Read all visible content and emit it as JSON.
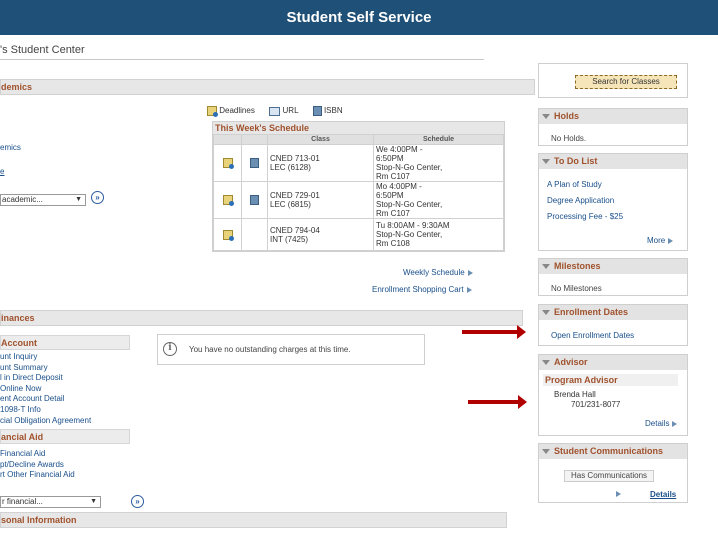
{
  "header": {
    "title": "Student Self Service"
  },
  "page": {
    "title": "'s Student Center"
  },
  "academics": {
    "section_title": "demics",
    "links": [
      "emics",
      "e"
    ],
    "dropdown": "academic...",
    "go": "»",
    "toolbar": {
      "deadlines": "Deadlines",
      "url": "URL",
      "isbn": "ISBN"
    },
    "schedule": {
      "title": "This Week's Schedule",
      "columns": [
        "Class",
        "Schedule"
      ],
      "rows": [
        {
          "class_line1": "CNED 713-01",
          "class_line2": "LEC (6128)",
          "sched": [
            "We 4:00PM -",
            "6:50PM",
            "Stop-N-Go Center,",
            "Rm C107"
          ]
        },
        {
          "class_line1": "CNED 729-01",
          "class_line2": "LEC (6815)",
          "sched": [
            "Mo 4:00PM -",
            "6:50PM",
            "Stop-N-Go Center,",
            "Rm C107"
          ]
        },
        {
          "class_line1": "CNED 794-04",
          "class_line2": "INT (7425)",
          "sched": [
            "Tu 8:00AM - 9:30AM",
            "Stop-N-Go Center,",
            "Rm C108"
          ]
        }
      ]
    },
    "weekly_schedule": "Weekly Schedule",
    "shopping_cart": "Enrollment Shopping Cart"
  },
  "finances": {
    "section_title": "inances",
    "account_title": "Account",
    "account_links": [
      "unt Inquiry",
      "unt Summary",
      "l in Direct Deposit",
      "Online Now",
      "ent Account Detail",
      "1098-T Info",
      "cial Obligation Agreement"
    ],
    "aid_title": "ancial Aid",
    "aid_links": [
      "Financial Aid",
      "pt/Decline Awards",
      "rt Other Financial Aid"
    ],
    "dropdown": "r financial...",
    "go": "»",
    "notice": "You have no outstanding charges at this time.",
    "info_glyph": "i"
  },
  "personal": {
    "section_title": "sonal Information"
  },
  "sidebar": {
    "search_button": "Search for Classes",
    "holds": {
      "title": "Holds",
      "text": "No Holds."
    },
    "todo": {
      "title": "To Do List",
      "items": [
        "A Plan of Study",
        "Degree Application",
        "Processing Fee - $25"
      ],
      "more": "More"
    },
    "milestones": {
      "title": "Milestones",
      "text": "No Milestones"
    },
    "enrollment": {
      "title": "Enrollment Dates",
      "link": "Open Enrollment Dates"
    },
    "advisor": {
      "title": "Advisor",
      "sub": "Program Advisor",
      "name": "Brenda Hall",
      "phone": "701/231-8077",
      "details": "Details"
    },
    "communications": {
      "title": "Student Communications",
      "button": "Has Communications",
      "details": "Details"
    }
  },
  "colors": {
    "header_bg": "#1f5077",
    "section_text": "#a0522d",
    "link": "#1a4f8a",
    "arrow": "#b00000"
  }
}
